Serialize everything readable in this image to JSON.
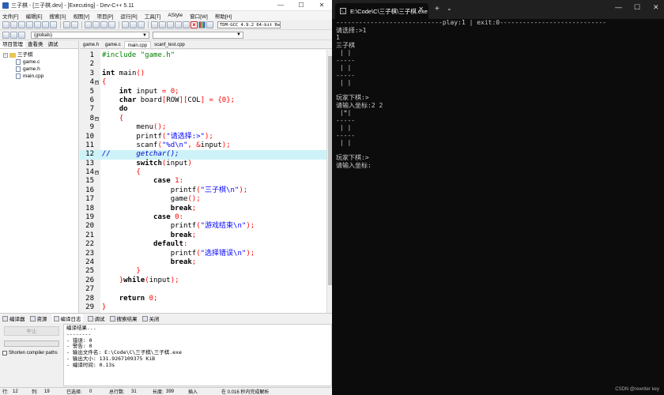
{
  "ide": {
    "title": "三子棋 - [三子棋.dev] - [Executing] - Dev-C++ 5.11",
    "window_controls": [
      "—",
      "☐",
      "✕"
    ],
    "menu": [
      "文件[F]",
      "编辑[E]",
      "搜索[S]",
      "视图[V]",
      "项目[P]",
      "运行[R]",
      "工具[T]",
      "AStyle",
      "窗口[W]",
      "帮助[H]"
    ],
    "compiler": "TDM-GCC 4.9.2 64-bit Re",
    "scope": "(globals)",
    "left_tabs": [
      "项目管理",
      "查看类",
      "调试"
    ],
    "project": {
      "name": "三子棋",
      "files": [
        "game.c",
        "game.h",
        "main.cpp"
      ]
    },
    "editor_tabs": [
      "game.h",
      "game.c",
      "main.cpp",
      "scanf_test.cpp"
    ],
    "active_tab": "main.cpp",
    "highlighted_line": 12,
    "code_lines": [
      {
        "n": "1",
        "fold": "",
        "segs": [
          {
            "t": "#include \"game.h\"",
            "c": "pp"
          }
        ]
      },
      {
        "n": "2",
        "fold": "",
        "segs": []
      },
      {
        "n": "3",
        "fold": "",
        "segs": [
          {
            "t": "int",
            "c": "kw"
          },
          {
            "t": " main",
            "c": ""
          },
          {
            "t": "()",
            "c": "sym"
          }
        ]
      },
      {
        "n": "4",
        "fold": "⊟",
        "segs": [
          {
            "t": "{",
            "c": "sym"
          }
        ]
      },
      {
        "n": "5",
        "fold": "",
        "segs": [
          {
            "t": "    ",
            "c": ""
          },
          {
            "t": "int",
            "c": "kw"
          },
          {
            "t": " input ",
            "c": ""
          },
          {
            "t": "=",
            "c": "sym"
          },
          {
            "t": " ",
            "c": ""
          },
          {
            "t": "0",
            "c": "num"
          },
          {
            "t": ";",
            "c": "sym"
          }
        ]
      },
      {
        "n": "6",
        "fold": "",
        "segs": [
          {
            "t": "    ",
            "c": ""
          },
          {
            "t": "char",
            "c": "kw"
          },
          {
            "t": " board",
            "c": ""
          },
          {
            "t": "[",
            "c": "sym"
          },
          {
            "t": "ROW",
            "c": ""
          },
          {
            "t": "][",
            "c": "sym"
          },
          {
            "t": "COL",
            "c": ""
          },
          {
            "t": "]",
            "c": "sym"
          },
          {
            "t": " ",
            "c": ""
          },
          {
            "t": "=",
            "c": "sym"
          },
          {
            "t": " ",
            "c": ""
          },
          {
            "t": "{",
            "c": "sym"
          },
          {
            "t": "0",
            "c": "num"
          },
          {
            "t": "};",
            "c": "sym"
          }
        ]
      },
      {
        "n": "7",
        "fold": "",
        "segs": [
          {
            "t": "    ",
            "c": ""
          },
          {
            "t": "do",
            "c": "kw"
          }
        ]
      },
      {
        "n": "8",
        "fold": "⊟",
        "segs": [
          {
            "t": "    ",
            "c": ""
          },
          {
            "t": "{",
            "c": "sym"
          }
        ]
      },
      {
        "n": "9",
        "fold": "",
        "segs": [
          {
            "t": "        menu",
            "c": ""
          },
          {
            "t": "();",
            "c": "sym"
          }
        ]
      },
      {
        "n": "10",
        "fold": "",
        "segs": [
          {
            "t": "        printf",
            "c": ""
          },
          {
            "t": "(",
            "c": "sym"
          },
          {
            "t": "\"请选择:>\"",
            "c": "str"
          },
          {
            "t": ");",
            "c": "sym"
          }
        ]
      },
      {
        "n": "11",
        "fold": "",
        "segs": [
          {
            "t": "        scanf",
            "c": ""
          },
          {
            "t": "(",
            "c": "sym"
          },
          {
            "t": "\"%d\\n\"",
            "c": "str"
          },
          {
            "t": ",",
            "c": "sym"
          },
          {
            "t": " ",
            "c": ""
          },
          {
            "t": "&",
            "c": "sym"
          },
          {
            "t": "input",
            "c": ""
          },
          {
            "t": ");",
            "c": "sym"
          }
        ]
      },
      {
        "n": "12",
        "fold": "",
        "segs": [
          {
            "t": "//      getchar();",
            "c": "cm"
          }
        ]
      },
      {
        "n": "13",
        "fold": "",
        "segs": [
          {
            "t": "        ",
            "c": ""
          },
          {
            "t": "switch",
            "c": "kw"
          },
          {
            "t": "(",
            "c": "sym"
          },
          {
            "t": "input",
            "c": ""
          },
          {
            "t": ")",
            "c": "sym"
          }
        ]
      },
      {
        "n": "14",
        "fold": "⊟",
        "segs": [
          {
            "t": "        ",
            "c": ""
          },
          {
            "t": "{",
            "c": "sym"
          }
        ]
      },
      {
        "n": "15",
        "fold": "",
        "segs": [
          {
            "t": "            ",
            "c": ""
          },
          {
            "t": "case",
            "c": "kw"
          },
          {
            "t": " ",
            "c": ""
          },
          {
            "t": "1",
            "c": "num"
          },
          {
            "t": ":",
            "c": "sym"
          }
        ]
      },
      {
        "n": "16",
        "fold": "",
        "segs": [
          {
            "t": "                printf",
            "c": ""
          },
          {
            "t": "(",
            "c": "sym"
          },
          {
            "t": "\"三子棋\\n\"",
            "c": "str"
          },
          {
            "t": ");",
            "c": "sym"
          }
        ]
      },
      {
        "n": "17",
        "fold": "",
        "segs": [
          {
            "t": "                game",
            "c": ""
          },
          {
            "t": "();",
            "c": "sym"
          }
        ]
      },
      {
        "n": "18",
        "fold": "",
        "segs": [
          {
            "t": "                ",
            "c": ""
          },
          {
            "t": "break",
            "c": "kw"
          },
          {
            "t": ";",
            "c": "sym"
          }
        ]
      },
      {
        "n": "19",
        "fold": "",
        "segs": [
          {
            "t": "            ",
            "c": ""
          },
          {
            "t": "case",
            "c": "kw"
          },
          {
            "t": " ",
            "c": ""
          },
          {
            "t": "0",
            "c": "num"
          },
          {
            "t": ":",
            "c": "sym"
          }
        ]
      },
      {
        "n": "20",
        "fold": "",
        "segs": [
          {
            "t": "                printf",
            "c": ""
          },
          {
            "t": "(",
            "c": "sym"
          },
          {
            "t": "\"游戏结束\\n\"",
            "c": "str"
          },
          {
            "t": ");",
            "c": "sym"
          }
        ]
      },
      {
        "n": "21",
        "fold": "",
        "segs": [
          {
            "t": "                ",
            "c": ""
          },
          {
            "t": "break",
            "c": "kw"
          },
          {
            "t": ";",
            "c": "sym"
          }
        ]
      },
      {
        "n": "22",
        "fold": "",
        "segs": [
          {
            "t": "            ",
            "c": ""
          },
          {
            "t": "default",
            "c": "kw"
          },
          {
            "t": ":",
            "c": "sym"
          }
        ]
      },
      {
        "n": "23",
        "fold": "",
        "segs": [
          {
            "t": "                printf",
            "c": ""
          },
          {
            "t": "(",
            "c": "sym"
          },
          {
            "t": "\"选择错误\\n\"",
            "c": "str"
          },
          {
            "t": ");",
            "c": "sym"
          }
        ]
      },
      {
        "n": "24",
        "fold": "",
        "segs": [
          {
            "t": "                ",
            "c": ""
          },
          {
            "t": "break",
            "c": "kw"
          },
          {
            "t": ";",
            "c": "sym"
          }
        ]
      },
      {
        "n": "25",
        "fold": "",
        "segs": [
          {
            "t": "        ",
            "c": ""
          },
          {
            "t": "}",
            "c": "sym"
          }
        ]
      },
      {
        "n": "26",
        "fold": "",
        "segs": [
          {
            "t": "    ",
            "c": ""
          },
          {
            "t": "}",
            "c": "sym"
          },
          {
            "t": "while",
            "c": "kw"
          },
          {
            "t": "(",
            "c": "sym"
          },
          {
            "t": "input",
            "c": ""
          },
          {
            "t": ");",
            "c": "sym"
          }
        ]
      },
      {
        "n": "27",
        "fold": "",
        "segs": []
      },
      {
        "n": "28",
        "fold": "",
        "segs": [
          {
            "t": "    ",
            "c": ""
          },
          {
            "t": "return",
            "c": "kw"
          },
          {
            "t": " ",
            "c": ""
          },
          {
            "t": "0",
            "c": "num"
          },
          {
            "t": ";",
            "c": "sym"
          }
        ]
      },
      {
        "n": "29",
        "fold": "",
        "segs": [
          {
            "t": "}",
            "c": "sym"
          }
        ]
      }
    ],
    "bottom_tabs": [
      "编译器",
      "资源",
      "编译日志",
      "调试",
      "搜索结果",
      "关闭"
    ],
    "abort_label": "中止",
    "shorten_label": "Shorten compiler paths",
    "log_lines": [
      "编译结果...",
      "--------",
      "- 错误: 0",
      "- 警告: 0",
      "- 输出文件名: E:\\Code\\C\\三子棋\\三子棋.exe",
      "- 输出大小: 131.9267109375 KiB",
      "- 编译时间: 0.13s"
    ],
    "status": {
      "row_label": "行:",
      "row": "12",
      "col_label": "列:",
      "col": "19",
      "selected_label": "已选择:",
      "selected": "0",
      "total_label": "总行数:",
      "total": "31",
      "length_label": "长度:",
      "length": "399",
      "mode": "插入",
      "parse": "在 0.016 秒内完成解析"
    }
  },
  "terminal": {
    "tab_title": "E:\\Code\\C\\三子棋\\三子棋.exe",
    "close_glyph": "✕",
    "new_tab_glyph": "+",
    "dropdown_glyph": "⌄",
    "window_controls": [
      "—",
      "☐",
      "✕"
    ],
    "lines": [
      "----------------------------play:1 | exit:0----------------------------",
      "请选择:>1",
      "1",
      "三子棋",
      " | |",
      "-----",
      " | |",
      "-----",
      " | |",
      "",
      "玩家下棋:>",
      "请输入坐标:2 2",
      " |*|",
      "-----",
      " | |",
      "-----",
      " | |",
      "",
      "玩家下棋:>",
      "请输入坐标:"
    ],
    "watermark": "CSDN @rewriter key"
  }
}
